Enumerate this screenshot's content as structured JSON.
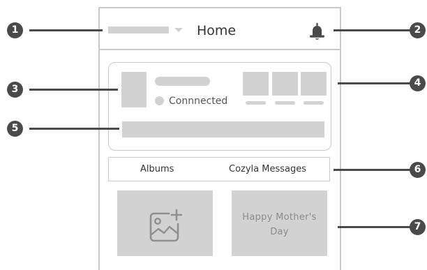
{
  "header": {
    "title": "Home"
  },
  "device_card": {
    "status_text": "Connnected"
  },
  "tabs": [
    {
      "label": "Albums"
    },
    {
      "label": "Cozyla Messages"
    }
  ],
  "tiles": {
    "album_icon": "add-photo-icon",
    "message_text": "Happy Mother's Day"
  },
  "callouts": [
    "1",
    "2",
    "3",
    "4",
    "5",
    "6",
    "7"
  ],
  "colors": {
    "placeholder": "#d2d2d2",
    "border": "#c9c9c9",
    "callout": "#4a4a4a"
  }
}
